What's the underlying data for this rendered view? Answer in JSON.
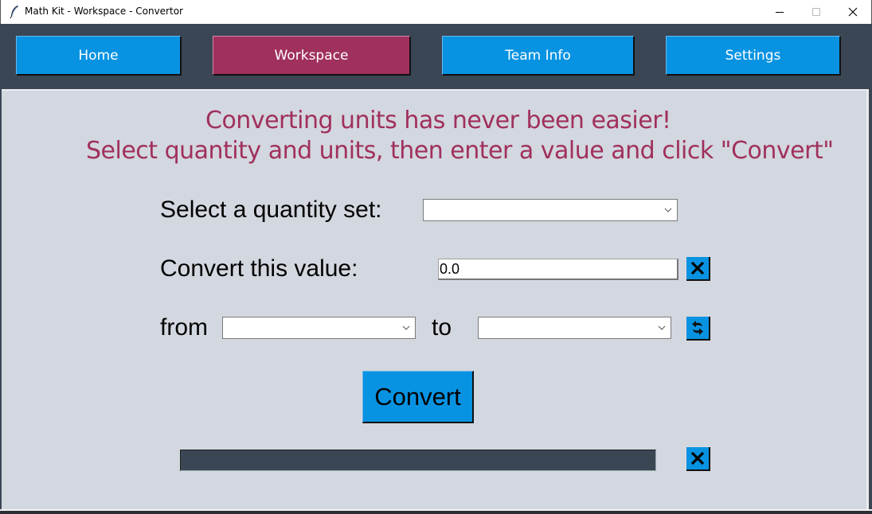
{
  "window": {
    "title": "Math Kit - Workspace - Convertor",
    "app_icon": "feather-icon",
    "controls": {
      "minimize": "minimize-icon",
      "maximize": "maximize-icon",
      "close": "close-icon"
    }
  },
  "nav": {
    "items": [
      {
        "label": "Home",
        "active": false
      },
      {
        "label": "Workspace",
        "active": true
      },
      {
        "label": "Team Info",
        "active": false
      },
      {
        "label": "Settings",
        "active": false
      }
    ]
  },
  "main": {
    "headline_line1": "Converting units has never been easier!",
    "headline_line2": "Select quantity and units, then enter a value and click \"Convert\"",
    "quantity_label": "Select a quantity set:",
    "quantity_value": "",
    "value_label": "Convert this value:",
    "value_input": "0.0",
    "clear_value_icon": "clear-x-icon",
    "from_label": "from",
    "from_unit": "",
    "to_label": "to",
    "to_unit": "",
    "swap_icon": "swap-arrows-icon",
    "convert_label": "Convert",
    "result_value": "",
    "clear_result_icon": "clear-x-icon"
  },
  "colors": {
    "accent_blue": "#0893e2",
    "accent_magenta": "#a0305e",
    "navbar_bg": "#3b4655",
    "content_bg": "#d3d7df"
  }
}
